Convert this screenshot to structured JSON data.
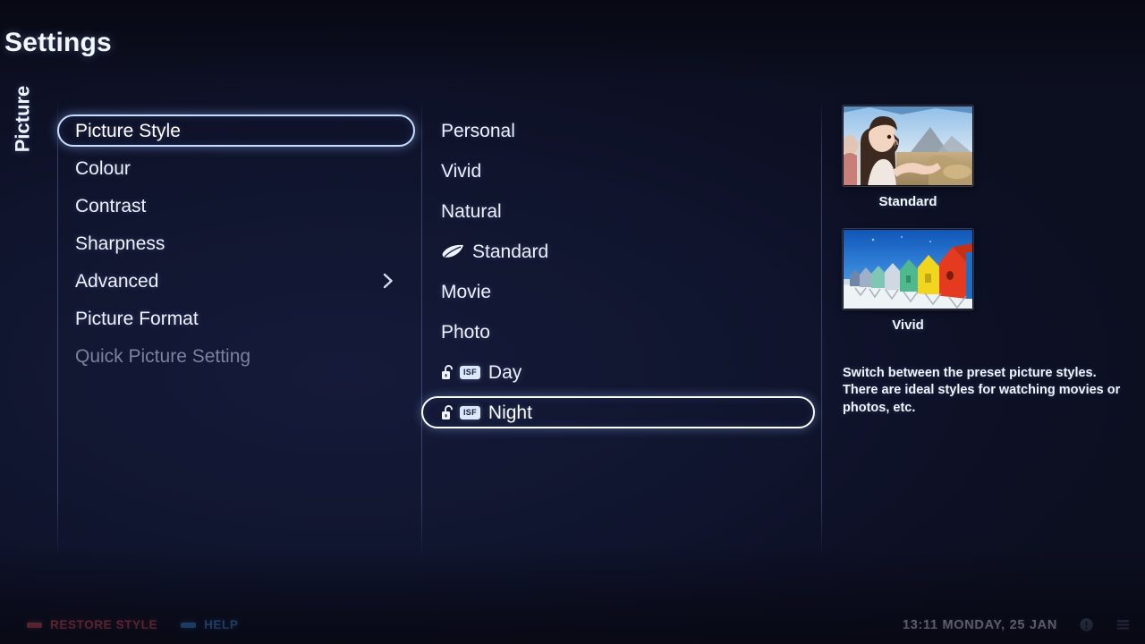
{
  "header": {
    "title": "Settings"
  },
  "category": {
    "label": "Picture"
  },
  "settings_menu": {
    "items": [
      {
        "label": "Picture Style",
        "selected": true,
        "disabled": false,
        "chevron": false
      },
      {
        "label": "Colour",
        "selected": false,
        "disabled": false,
        "chevron": false
      },
      {
        "label": "Contrast",
        "selected": false,
        "disabled": false,
        "chevron": false
      },
      {
        "label": "Sharpness",
        "selected": false,
        "disabled": false,
        "chevron": false
      },
      {
        "label": "Advanced",
        "selected": false,
        "disabled": false,
        "chevron": true
      },
      {
        "label": "Picture Format",
        "selected": false,
        "disabled": false,
        "chevron": false
      },
      {
        "label": "Quick Picture Setting",
        "selected": false,
        "disabled": true,
        "chevron": false
      }
    ]
  },
  "style_menu": {
    "items": [
      {
        "label": "Personal",
        "selected": false,
        "icons": []
      },
      {
        "label": "Vivid",
        "selected": false,
        "icons": []
      },
      {
        "label": "Natural",
        "selected": false,
        "icons": []
      },
      {
        "label": "Standard",
        "selected": false,
        "icons": [
          "leaf-icon"
        ]
      },
      {
        "label": "Movie",
        "selected": false,
        "icons": []
      },
      {
        "label": "Photo",
        "selected": false,
        "icons": []
      },
      {
        "label": "Day",
        "selected": false,
        "icons": [
          "unlock-icon",
          "isf-badge"
        ],
        "badge_text": "ISF"
      },
      {
        "label": "Night",
        "selected": true,
        "icons": [
          "unlock-icon",
          "isf-badge"
        ],
        "badge_text": "ISF"
      }
    ]
  },
  "preview": {
    "cards": [
      {
        "caption": "Standard",
        "thumb": "girl-mountain-photo"
      },
      {
        "caption": "Vivid",
        "thumb": "beach-huts-photo"
      }
    ],
    "description": "Switch between the preset picture styles. There are ideal styles for watching movies or photos, etc."
  },
  "footer": {
    "actions": [
      {
        "label": "RESTORE STYLE",
        "color": "#e8566a",
        "icon": "red-dash-icon"
      },
      {
        "label": "HELP",
        "color": "#4d9af5",
        "icon": "blue-dash-icon"
      }
    ],
    "clock": "13:11 MONDAY, 25 JAN",
    "icons": [
      "info-circle-icon",
      "menu-lines-icon"
    ]
  },
  "colors": {
    "background": "#111530",
    "highlight_border": "#ffffff",
    "text_primary": "#f0f4ff",
    "text_disabled": "#7a829e",
    "accent_red": "#e8566a",
    "accent_blue": "#4d9af5",
    "isf_badge_bg": "#dfe9fb"
  }
}
